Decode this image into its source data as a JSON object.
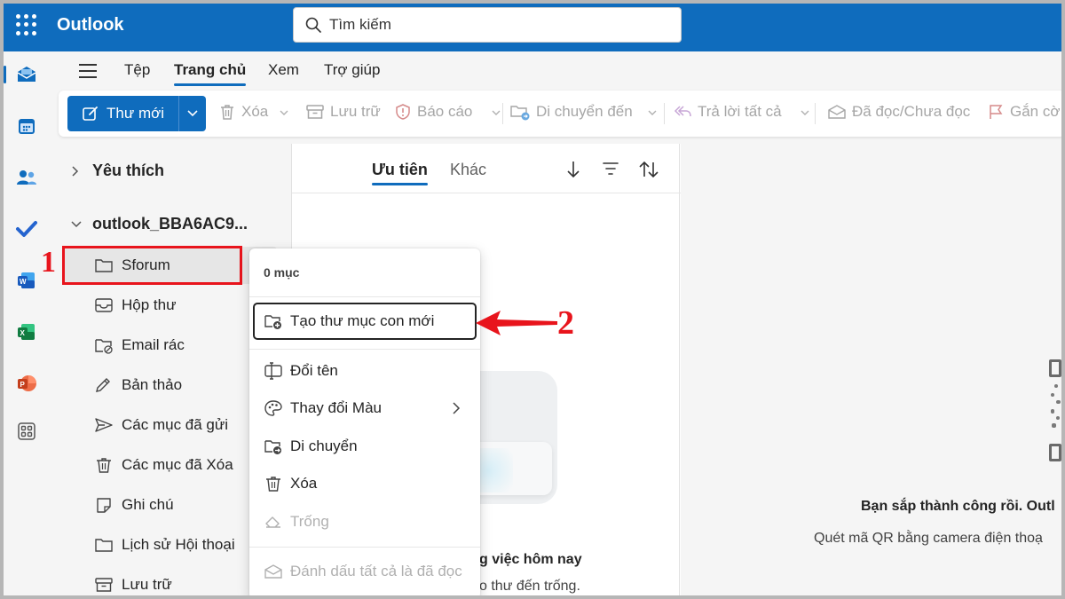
{
  "header": {
    "app_name": "Outlook",
    "search_placeholder": "Tìm kiếm",
    "brand_color": "#0f6cbd"
  },
  "rail": [
    "mail-icon",
    "calendar-icon",
    "people-icon",
    "todo-icon",
    "word-icon",
    "excel-icon",
    "powerpoint-icon",
    "apps-icon"
  ],
  "menu": {
    "tabs": [
      "Tệp",
      "Trang chủ",
      "Xem",
      "Trợ giúp"
    ],
    "active": "Trang chủ"
  },
  "toolbar": {
    "new_mail": "Thư mới",
    "delete": "Xóa",
    "archive": "Lưu trữ",
    "report": "Báo cáo",
    "move_to": "Di chuyển đến",
    "reply_all": "Trả lời tất cả",
    "read_unread": "Đã đọc/Chưa đọc",
    "flag": "Gắn cờ"
  },
  "folders": {
    "favorites": "Yêu thích",
    "account": "outlook_BBA6AC9...",
    "items": [
      "Sforum",
      "Hộp thư",
      "Email rác",
      "Bản thảo",
      "Các mục đã gửi",
      "Các mục đã Xóa",
      "Ghi chú",
      "Lịch sử Hội thoại",
      "Lưu trữ"
    ]
  },
  "list": {
    "tabs": [
      "Ưu tiên",
      "Khác"
    ],
    "empty_title": "g việc hôm nay",
    "empty_sub": "o thư đến trống."
  },
  "context_menu": {
    "count": "0 mục",
    "items": [
      {
        "label": "Tạo thư mục con mới",
        "icon": "folder-add-icon",
        "disabled": false
      },
      {
        "label": "Đổi tên",
        "icon": "rename-icon",
        "disabled": false
      },
      {
        "label": "Thay đổi Màu",
        "icon": "palette-icon",
        "disabled": false
      },
      {
        "label": "Di chuyển",
        "icon": "folder-move-icon",
        "disabled": false
      },
      {
        "label": "Xóa",
        "icon": "trash-icon",
        "disabled": false
      },
      {
        "label": "Trống",
        "icon": "erase-icon",
        "disabled": true
      },
      {
        "label": "Đánh dấu tất cả là đã đọc",
        "icon": "mail-read-icon",
        "disabled": true
      }
    ]
  },
  "reading": {
    "title": "Bạn sắp thành công rồi. Outl",
    "sub": "Quét mã QR bằng camera điện thoạ"
  },
  "annotations": {
    "step1": "1",
    "step2": "2",
    "color": "#e8141c"
  }
}
